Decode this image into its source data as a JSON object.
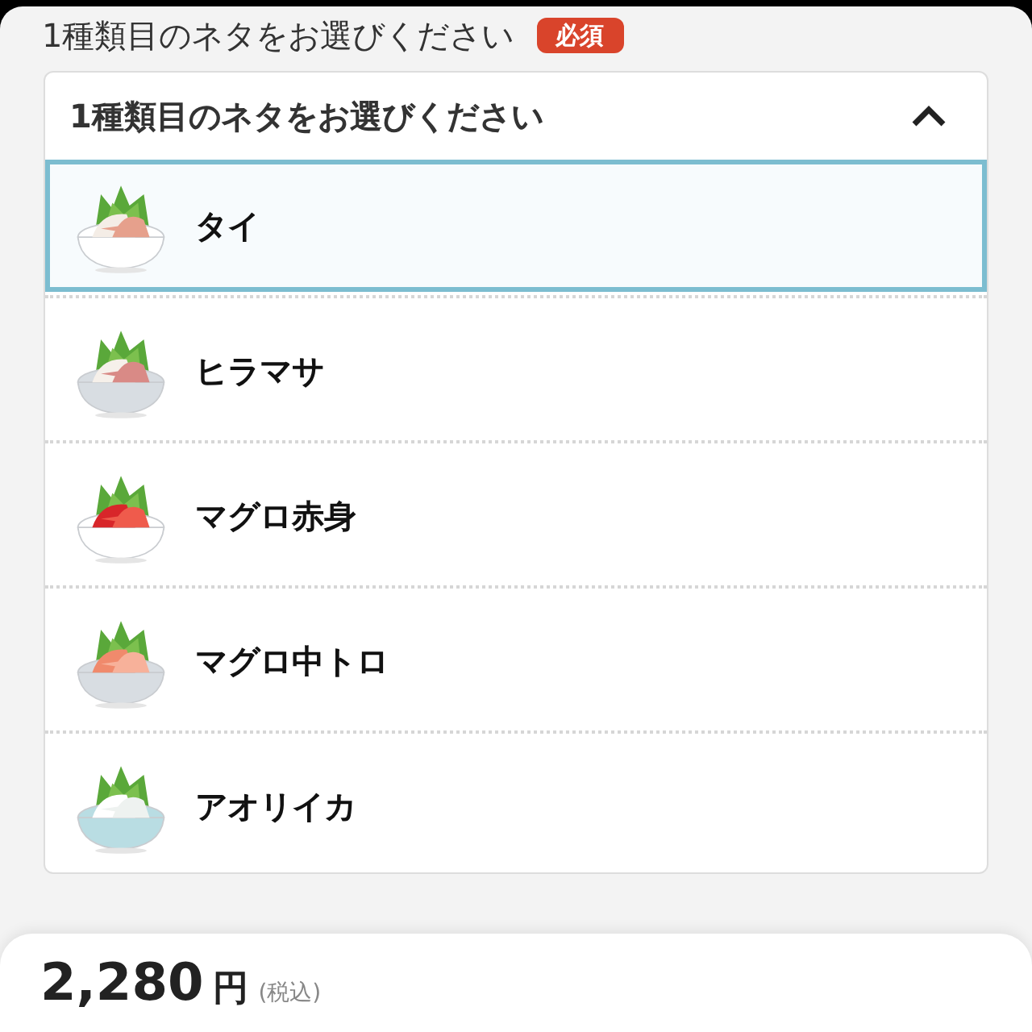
{
  "section": {
    "title": "1種類目のネタをお選びください",
    "badge": "必須"
  },
  "dropdown": {
    "label": "1種類目のネタをお選びください",
    "expanded": true,
    "options": [
      {
        "name": "タイ",
        "selected": true
      },
      {
        "name": "ヒラマサ",
        "selected": false
      },
      {
        "name": "マグロ赤身",
        "selected": false
      },
      {
        "name": "マグロ中トロ",
        "selected": false
      },
      {
        "name": "アオリイカ",
        "selected": false
      }
    ]
  },
  "footer": {
    "price": "2,280",
    "currency": "円",
    "tax_note": "(税込)"
  }
}
